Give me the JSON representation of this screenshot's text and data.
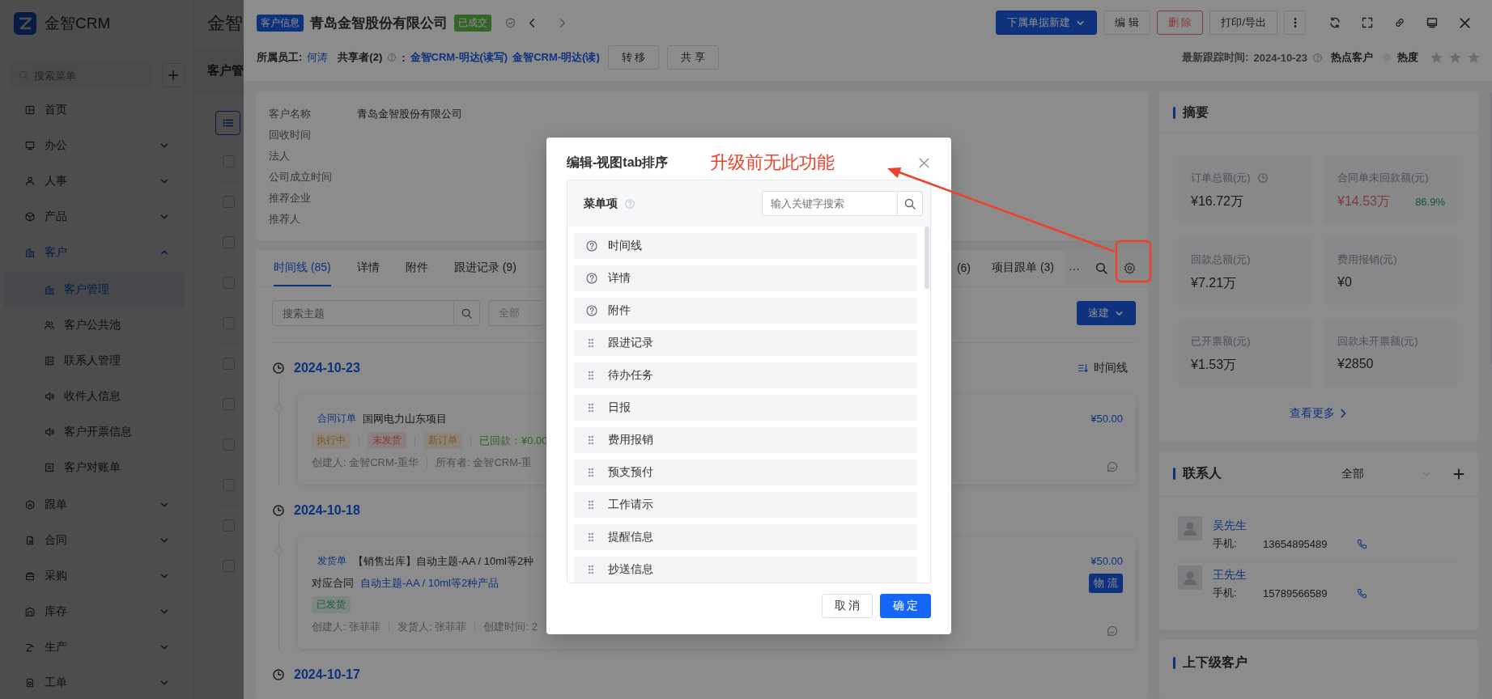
{
  "sidebar": {
    "logo_text": "金智CRM",
    "search_placeholder": "搜索菜单",
    "items": [
      {
        "label": "首页",
        "selected": false
      },
      {
        "label": "办公",
        "selected": false,
        "expanded": false
      },
      {
        "label": "人事",
        "selected": false,
        "expanded": false
      },
      {
        "label": "产品",
        "selected": false,
        "expanded": false
      },
      {
        "label": "客户",
        "selected": true,
        "expanded": true,
        "children": [
          {
            "label": "客户管理",
            "selected": true
          },
          {
            "label": "客户公共池",
            "selected": false
          },
          {
            "label": "联系人管理",
            "selected": false
          },
          {
            "label": "收件人信息",
            "selected": false
          },
          {
            "label": "客户开票信息",
            "selected": false
          },
          {
            "label": "客户对账单",
            "selected": false
          }
        ]
      },
      {
        "label": "跟单",
        "selected": false,
        "expanded": false
      },
      {
        "label": "合同",
        "selected": false,
        "expanded": false
      },
      {
        "label": "采购",
        "selected": false,
        "expanded": false
      },
      {
        "label": "库存",
        "selected": false,
        "expanded": false
      },
      {
        "label": "生产",
        "selected": false,
        "expanded": false
      },
      {
        "label": "工单",
        "selected": false,
        "expanded": false
      }
    ]
  },
  "page": {
    "title": "金智",
    "tab": "客户管"
  },
  "list_rows": [
    {
      "checked": false
    },
    {
      "checked": false
    },
    {
      "checked": false
    },
    {
      "checked": false
    },
    {
      "checked": false
    },
    {
      "checked": false
    },
    {
      "checked": false
    },
    {
      "checked": false
    },
    {
      "checked": false
    },
    {
      "checked": false
    },
    {
      "checked": false
    }
  ],
  "header": {
    "tag": "客户信息",
    "title": "青岛金智股份有限公司",
    "status": "已成交",
    "actions": [
      {
        "label": "下属单据新建",
        "kind": "primary"
      },
      {
        "label": "编 辑",
        "kind": "default"
      },
      {
        "label": "删 除",
        "kind": "danger"
      },
      {
        "label": "打印/导出",
        "kind": "default"
      }
    ]
  },
  "owner_row": {
    "owner_label": "所属员工:",
    "owner": "何涛",
    "sharers_label": "共享者(2)",
    "colon": ":",
    "sharers": [
      "金智CRM-明达(读写)",
      "金智CRM-明达(读)"
    ],
    "buttons": [
      "转 移",
      "共 享"
    ],
    "last_track_label": "最新跟踪时间:",
    "last_track": "2024-10-23",
    "hot_label": "热点客户",
    "heat_label": "热度",
    "stars": 0
  },
  "info": {
    "left": [
      {
        "label": "客户名称",
        "value": "青岛金智股份有限公司"
      },
      {
        "label": "回收时间"
      },
      {
        "label": "法人"
      },
      {
        "label": "公司成立时间"
      },
      {
        "label": "推荐企业"
      },
      {
        "label": "推荐人"
      }
    ]
  },
  "tabs_left": [
    {
      "label": "时间线 (85)",
      "selected": true
    },
    {
      "label": "详情",
      "selected": false
    },
    {
      "label": "附件",
      "selected": false
    },
    {
      "label": "跟进记录 (9)",
      "selected": false
    }
  ],
  "tabs_right": [
    {
      "label": "(6)",
      "selected": false
    },
    {
      "label": "项目跟单 (3)",
      "selected": false
    }
  ],
  "tabs_more": "···",
  "filter": {
    "search_placeholder": "搜索主题",
    "type_value": "全部",
    "quick_button": "速建"
  },
  "timeline": {
    "sort_label": "时间线",
    "groups": [
      {
        "date": "2024-10-23",
        "entries": [
          {
            "kind": "order",
            "type": "合同订单",
            "title": "国网电力山东项目",
            "tags": [
              {
                "text": "执行中",
                "kind": "warning"
              },
              {
                "text": "未发货",
                "kind": "danger"
              },
              {
                "text": "新订单",
                "kind": "warning"
              }
            ],
            "paid": "已回款：¥0.00",
            "meta": [
              "创建人: 金智CRM-重华",
              "所有者: 金智CRM-重"
            ],
            "amount": "¥50.00"
          }
        ]
      },
      {
        "date": "2024-10-18",
        "entries": [
          {
            "kind": "shipment",
            "type": "发货单",
            "title": "【销售出库】自动主题-AA / 10ml等2种",
            "contract_label": "对应合同",
            "contract": "自动主题-AA / 10ml等2种产品",
            "tags": [
              {
                "text": "已发货",
                "kind": "success"
              }
            ],
            "meta": [
              "创建人: 张菲菲",
              "发货人: 张菲菲",
              "创建时间: 2"
            ],
            "amount": "¥50.00",
            "action": "物 流"
          }
        ]
      },
      {
        "date": "2024-10-17"
      }
    ]
  },
  "summary": {
    "title": "摘要",
    "stats": [
      {
        "label": "订单总额(元)",
        "value": "¥16.72万",
        "clock": true
      },
      {
        "label": "合同单未回款额(元)",
        "value": "¥14.53万",
        "kind": "alert",
        "ratio": "86.9%"
      },
      {
        "label": "回款总额(元)",
        "value": "¥7.21万"
      },
      {
        "label": "费用报销(元)",
        "value": "¥0"
      },
      {
        "label": "已开票额(元)",
        "value": "¥1.53万"
      },
      {
        "label": "回款未开票额(元)",
        "value": "¥2850"
      }
    ],
    "more": "查看更多"
  },
  "contacts": {
    "title": "联系人",
    "filter": "全部",
    "people": [
      {
        "name": "吴先生",
        "phone_label": "手机:",
        "phone": "13654895489"
      },
      {
        "name": "王先生",
        "phone_label": "手机:",
        "phone": "15789566589"
      }
    ]
  },
  "related": {
    "title": "上下级客户"
  },
  "modal": {
    "title": "编辑-视图tab排序",
    "panel_title": "菜单项",
    "search_placeholder": "输入关键字搜索",
    "items": [
      {
        "label": "时间线",
        "kind": "fixed"
      },
      {
        "label": "详情",
        "kind": "fixed"
      },
      {
        "label": "附件",
        "kind": "fixed"
      },
      {
        "label": "跟进记录",
        "kind": "draggable"
      },
      {
        "label": "待办任务",
        "kind": "draggable"
      },
      {
        "label": "日报",
        "kind": "draggable"
      },
      {
        "label": "费用报销",
        "kind": "draggable"
      },
      {
        "label": "预支预付",
        "kind": "draggable"
      },
      {
        "label": "工作请示",
        "kind": "draggable"
      },
      {
        "label": "提醒信息",
        "kind": "draggable"
      },
      {
        "label": "抄送信息",
        "kind": "draggable"
      }
    ],
    "cancel": "取 消",
    "ok": "确 定"
  },
  "annotation": {
    "text": "升级前无此功能"
  }
}
